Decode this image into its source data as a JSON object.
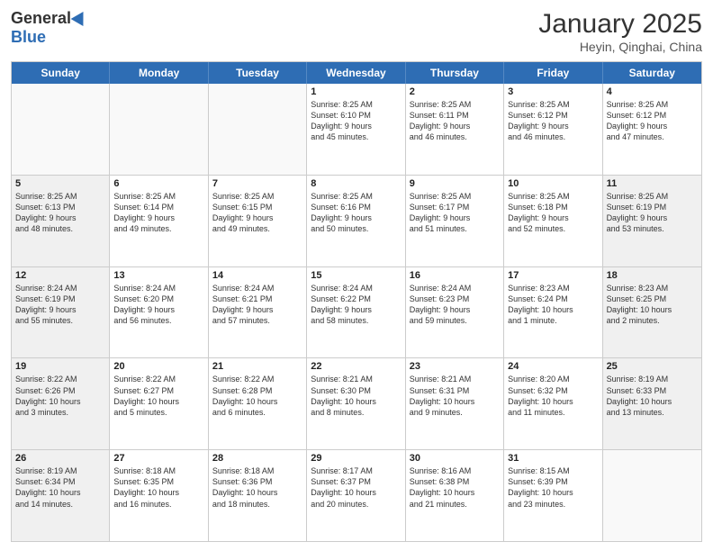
{
  "logo": {
    "general": "General",
    "blue": "Blue"
  },
  "header": {
    "title": "January 2025",
    "location": "Heyin, Qinghai, China"
  },
  "weekdays": [
    "Sunday",
    "Monday",
    "Tuesday",
    "Wednesday",
    "Thursday",
    "Friday",
    "Saturday"
  ],
  "rows": [
    [
      {
        "day": "",
        "info": "",
        "empty": true
      },
      {
        "day": "",
        "info": "",
        "empty": true
      },
      {
        "day": "",
        "info": "",
        "empty": true
      },
      {
        "day": "1",
        "info": "Sunrise: 8:25 AM\nSunset: 6:10 PM\nDaylight: 9 hours\nand 45 minutes.",
        "empty": false
      },
      {
        "day": "2",
        "info": "Sunrise: 8:25 AM\nSunset: 6:11 PM\nDaylight: 9 hours\nand 46 minutes.",
        "empty": false
      },
      {
        "day": "3",
        "info": "Sunrise: 8:25 AM\nSunset: 6:12 PM\nDaylight: 9 hours\nand 46 minutes.",
        "empty": false
      },
      {
        "day": "4",
        "info": "Sunrise: 8:25 AM\nSunset: 6:12 PM\nDaylight: 9 hours\nand 47 minutes.",
        "empty": false
      }
    ],
    [
      {
        "day": "5",
        "info": "Sunrise: 8:25 AM\nSunset: 6:13 PM\nDaylight: 9 hours\nand 48 minutes.",
        "shaded": true
      },
      {
        "day": "6",
        "info": "Sunrise: 8:25 AM\nSunset: 6:14 PM\nDaylight: 9 hours\nand 49 minutes.",
        "shaded": false
      },
      {
        "day": "7",
        "info": "Sunrise: 8:25 AM\nSunset: 6:15 PM\nDaylight: 9 hours\nand 49 minutes.",
        "shaded": false
      },
      {
        "day": "8",
        "info": "Sunrise: 8:25 AM\nSunset: 6:16 PM\nDaylight: 9 hours\nand 50 minutes.",
        "shaded": false
      },
      {
        "day": "9",
        "info": "Sunrise: 8:25 AM\nSunset: 6:17 PM\nDaylight: 9 hours\nand 51 minutes.",
        "shaded": false
      },
      {
        "day": "10",
        "info": "Sunrise: 8:25 AM\nSunset: 6:18 PM\nDaylight: 9 hours\nand 52 minutes.",
        "shaded": false
      },
      {
        "day": "11",
        "info": "Sunrise: 8:25 AM\nSunset: 6:19 PM\nDaylight: 9 hours\nand 53 minutes.",
        "shaded": true
      }
    ],
    [
      {
        "day": "12",
        "info": "Sunrise: 8:24 AM\nSunset: 6:19 PM\nDaylight: 9 hours\nand 55 minutes.",
        "shaded": true
      },
      {
        "day": "13",
        "info": "Sunrise: 8:24 AM\nSunset: 6:20 PM\nDaylight: 9 hours\nand 56 minutes.",
        "shaded": false
      },
      {
        "day": "14",
        "info": "Sunrise: 8:24 AM\nSunset: 6:21 PM\nDaylight: 9 hours\nand 57 minutes.",
        "shaded": false
      },
      {
        "day": "15",
        "info": "Sunrise: 8:24 AM\nSunset: 6:22 PM\nDaylight: 9 hours\nand 58 minutes.",
        "shaded": false
      },
      {
        "day": "16",
        "info": "Sunrise: 8:24 AM\nSunset: 6:23 PM\nDaylight: 9 hours\nand 59 minutes.",
        "shaded": false
      },
      {
        "day": "17",
        "info": "Sunrise: 8:23 AM\nSunset: 6:24 PM\nDaylight: 10 hours\nand 1 minute.",
        "shaded": false
      },
      {
        "day": "18",
        "info": "Sunrise: 8:23 AM\nSunset: 6:25 PM\nDaylight: 10 hours\nand 2 minutes.",
        "shaded": true
      }
    ],
    [
      {
        "day": "19",
        "info": "Sunrise: 8:22 AM\nSunset: 6:26 PM\nDaylight: 10 hours\nand 3 minutes.",
        "shaded": true
      },
      {
        "day": "20",
        "info": "Sunrise: 8:22 AM\nSunset: 6:27 PM\nDaylight: 10 hours\nand 5 minutes.",
        "shaded": false
      },
      {
        "day": "21",
        "info": "Sunrise: 8:22 AM\nSunset: 6:28 PM\nDaylight: 10 hours\nand 6 minutes.",
        "shaded": false
      },
      {
        "day": "22",
        "info": "Sunrise: 8:21 AM\nSunset: 6:30 PM\nDaylight: 10 hours\nand 8 minutes.",
        "shaded": false
      },
      {
        "day": "23",
        "info": "Sunrise: 8:21 AM\nSunset: 6:31 PM\nDaylight: 10 hours\nand 9 minutes.",
        "shaded": false
      },
      {
        "day": "24",
        "info": "Sunrise: 8:20 AM\nSunset: 6:32 PM\nDaylight: 10 hours\nand 11 minutes.",
        "shaded": false
      },
      {
        "day": "25",
        "info": "Sunrise: 8:19 AM\nSunset: 6:33 PM\nDaylight: 10 hours\nand 13 minutes.",
        "shaded": true
      }
    ],
    [
      {
        "day": "26",
        "info": "Sunrise: 8:19 AM\nSunset: 6:34 PM\nDaylight: 10 hours\nand 14 minutes.",
        "shaded": true
      },
      {
        "day": "27",
        "info": "Sunrise: 8:18 AM\nSunset: 6:35 PM\nDaylight: 10 hours\nand 16 minutes.",
        "shaded": false
      },
      {
        "day": "28",
        "info": "Sunrise: 8:18 AM\nSunset: 6:36 PM\nDaylight: 10 hours\nand 18 minutes.",
        "shaded": false
      },
      {
        "day": "29",
        "info": "Sunrise: 8:17 AM\nSunset: 6:37 PM\nDaylight: 10 hours\nand 20 minutes.",
        "shaded": false
      },
      {
        "day": "30",
        "info": "Sunrise: 8:16 AM\nSunset: 6:38 PM\nDaylight: 10 hours\nand 21 minutes.",
        "shaded": false
      },
      {
        "day": "31",
        "info": "Sunrise: 8:15 AM\nSunset: 6:39 PM\nDaylight: 10 hours\nand 23 minutes.",
        "shaded": false
      },
      {
        "day": "",
        "info": "",
        "empty": true
      }
    ]
  ]
}
